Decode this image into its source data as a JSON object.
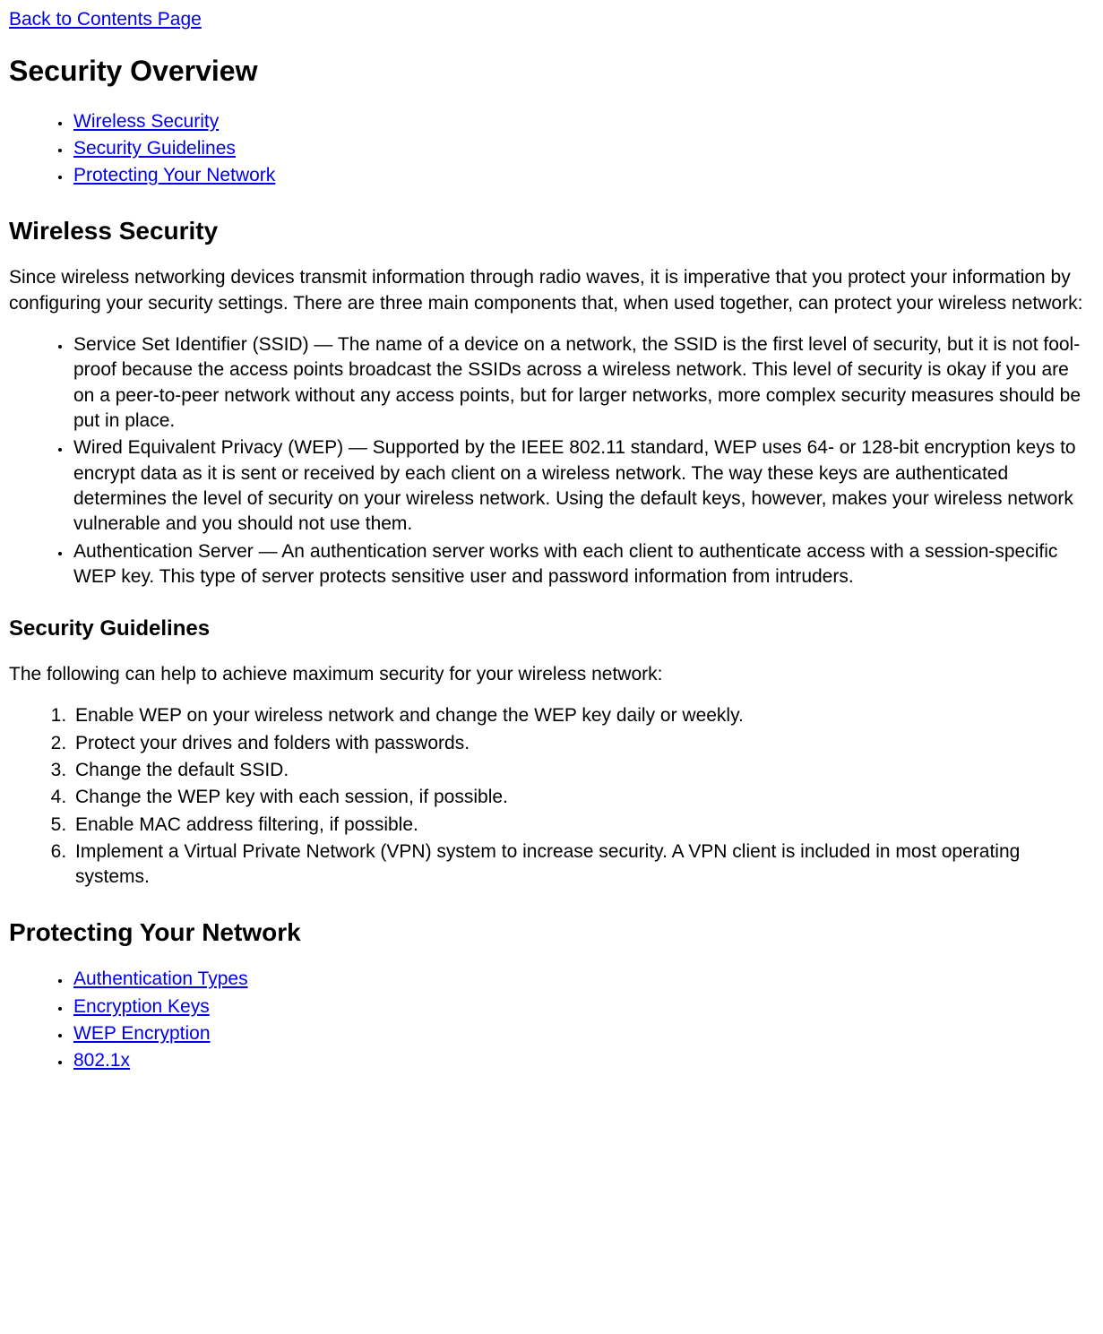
{
  "nav": {
    "back_link": "Back to Contents Page"
  },
  "headings": {
    "h1": "Security Overview",
    "h2_wireless": "Wireless Security",
    "h3_guidelines": "Security Guidelines",
    "h2_protecting": "Protecting Your Network"
  },
  "toc": {
    "items": [
      "Wireless Security",
      "Security Guidelines",
      "Protecting Your Network"
    ]
  },
  "wireless_intro": "Since wireless networking devices transmit information through radio waves, it is imperative that you protect your information by configuring your security settings. There are three main components that, when used together, can protect your wireless network:",
  "wireless_components": [
    "Service Set Identifier (SSID) — The name of a device on a network, the SSID is the first level of security, but it is not fool-proof because the access points broadcast the SSIDs across a wireless network. This level of security is okay if you are on a peer-to-peer network without any access points, but for larger networks, more complex security measures should be put in place.",
    "Wired Equivalent Privacy (WEP) — Supported by the IEEE 802.11 standard, WEP uses 64- or 128-bit encryption keys to encrypt data as it is sent or received by each client on a wireless network. The way these keys are authenticated determines the level of security on your wireless network. Using the default keys, however, makes your wireless network vulnerable and you should not use them.",
    "Authentication Server — An authentication server works with each client to authenticate access with a session-specific WEP key. This type of server protects sensitive user and password information from intruders."
  ],
  "guidelines_intro": "The following can help to achieve maximum security for your wireless network:",
  "guidelines_list": [
    "Enable WEP on your wireless network and change the WEP key daily or weekly.",
    "Protect your drives and folders with passwords.",
    "Change the default SSID.",
    "Change the WEP key with each session, if possible.",
    "Enable MAC address filtering, if possible.",
    "Implement a Virtual Private Network (VPN) system to increase security. A VPN client is included in most operating systems."
  ],
  "protecting_toc": [
    "Authentication Types",
    "Encryption Keys",
    "WEP Encryption",
    "802.1x"
  ]
}
